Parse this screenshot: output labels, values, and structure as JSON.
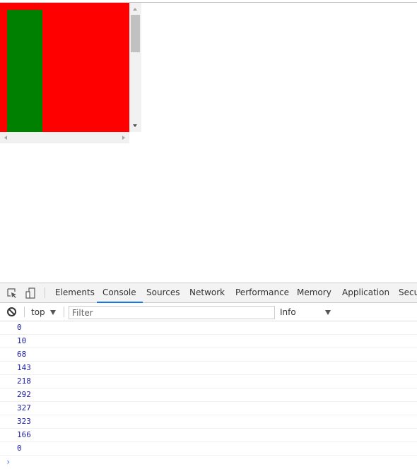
{
  "page": {
    "scroll_box": {
      "background_color": "#ff0000",
      "inner_bar_color": "#008000"
    }
  },
  "devtools": {
    "tabs": [
      {
        "label": "Elements",
        "active": false
      },
      {
        "label": "Console",
        "active": true
      },
      {
        "label": "Sources",
        "active": false
      },
      {
        "label": "Network",
        "active": false
      },
      {
        "label": "Performance",
        "active": false
      },
      {
        "label": "Memory",
        "active": false
      },
      {
        "label": "Application",
        "active": false
      },
      {
        "label": "Secu",
        "active": false
      }
    ],
    "toolbar": {
      "context": "top",
      "filter_placeholder": "Filter",
      "filter_value": "",
      "level": "Info"
    },
    "console": {
      "logs": [
        "0",
        "10",
        "68",
        "143",
        "218",
        "292",
        "327",
        "323",
        "166",
        "0"
      ],
      "prompt_glyph": "›"
    },
    "accent_color": "#1a73e8",
    "log_color": "#1a1aa6"
  }
}
